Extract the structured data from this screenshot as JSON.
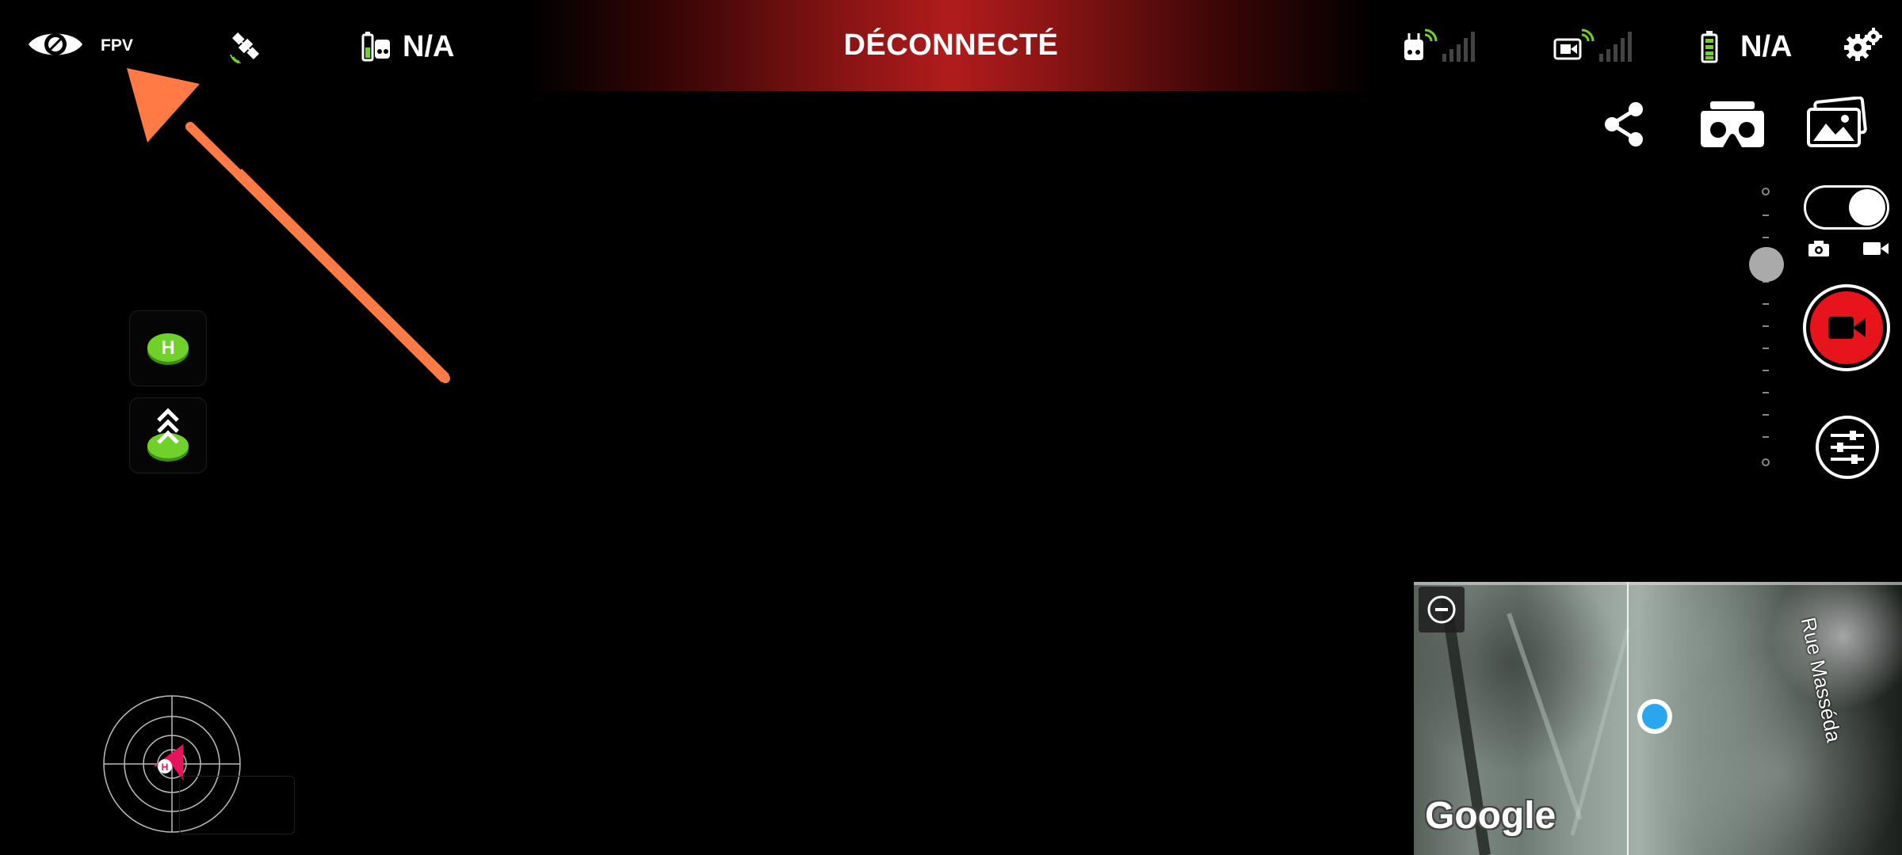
{
  "header": {
    "fpv_label": "FPV",
    "remote_battery": "N/A",
    "connection_status": "DÉCONNECTÉ",
    "drone_battery": "N/A"
  },
  "icons": {
    "eye": "eye-icon",
    "satellite": "satellite-icon",
    "remote_battery": "remote-battery-icon",
    "rc_signal": "rc-signal-icon",
    "video_signal": "video-signal-icon",
    "drone_battery": "battery-icon",
    "settings": "gears-icon",
    "share": "share-icon",
    "vr": "vr-headset-icon",
    "gallery": "gallery-icon",
    "photo": "camera-icon",
    "video": "video-icon",
    "record": "record-video-icon",
    "camera_settings": "sliders-icon",
    "home": "home-point-icon",
    "takeoff": "takeoff-icon",
    "zoom_out": "minus-icon"
  },
  "map": {
    "street_label": "Rue Masséda",
    "attribution": "Google"
  },
  "colors": {
    "accent_green": "#6fd12a",
    "record_red": "#e8141b",
    "status_red": "#b11c1c",
    "arrow_orange": "#ff7a45",
    "location_blue": "#2aa6ee"
  },
  "camera": {
    "mode_video_selected": true
  }
}
